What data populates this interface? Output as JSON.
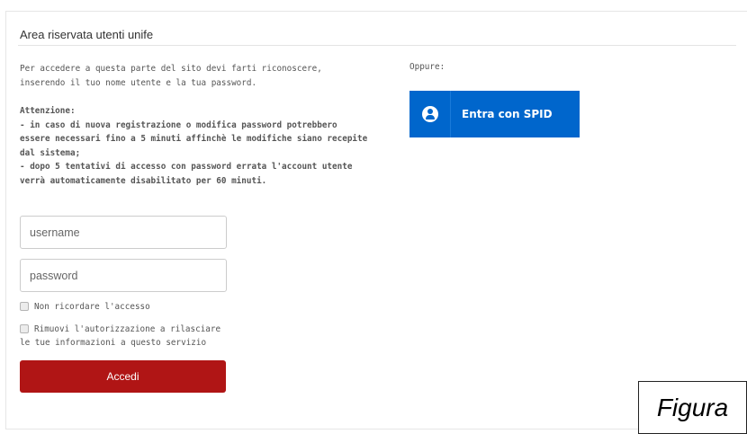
{
  "section": {
    "title": "Area riservata utenti unife"
  },
  "intro": {
    "line1": "Per accedere a questa parte del sito devi farti riconoscere,",
    "line2": "inserendo il tuo nome utente e la tua password."
  },
  "warning": {
    "heading": "Attenzione:",
    "line1": "- in caso di nuova registrazione o modifica password potrebbero",
    "line2": "essere necessari fino a 5 minuti affinchè le modifiche siano recepite",
    "line3": "dal sistema;",
    "line4": "- dopo 5 tentativi di accesso con password errata l'account utente",
    "line5": "verrà automaticamente disabilitato per 60 minuti."
  },
  "alt_login": {
    "label": "Oppure:",
    "spid_button": "Entra con SPID",
    "spid_icon": "user-icon",
    "color": "#0066cc"
  },
  "form": {
    "username_placeholder": "username",
    "password_placeholder": "password",
    "remember_label": "Non ricordare l'accesso",
    "revoke_label_line1": "Rimuovi l'autorizzazione a rilasciare",
    "revoke_label_line2": "le tue informazioni a questo servizio",
    "submit_label": "Accedi",
    "submit_color": "#b01515"
  },
  "caption": {
    "text": "Figura"
  }
}
